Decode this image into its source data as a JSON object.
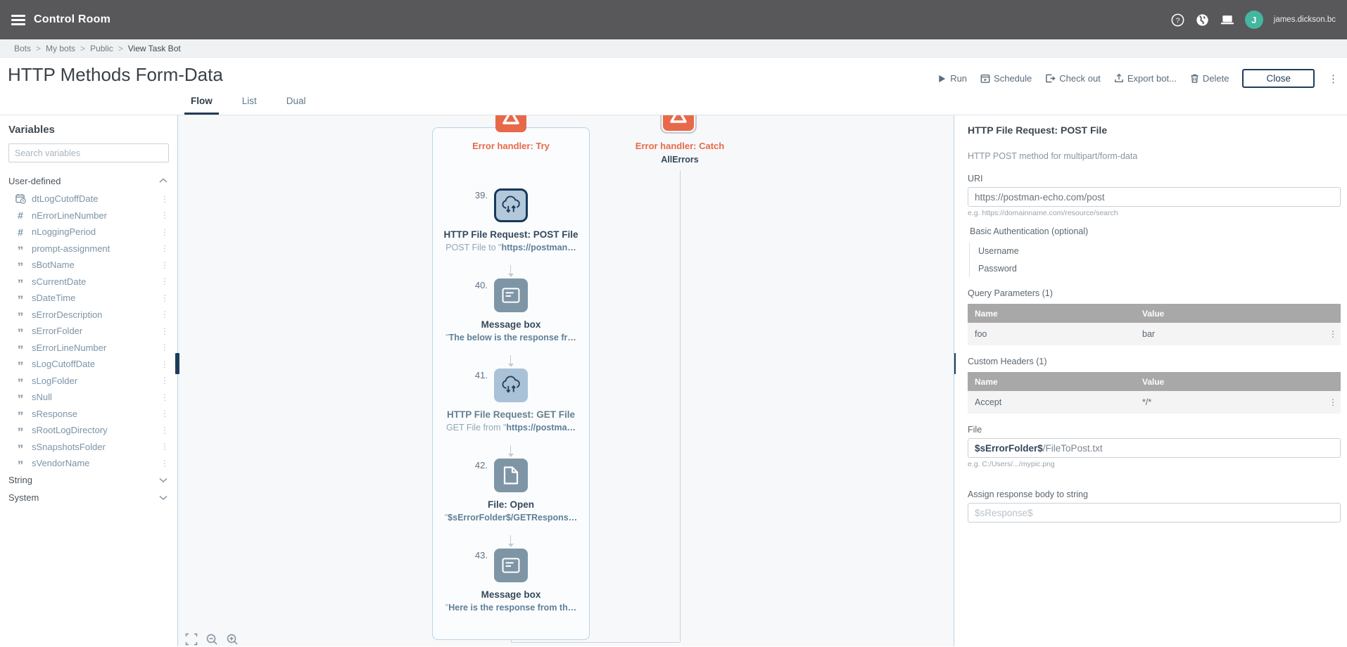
{
  "topbar": {
    "brand": "Control Room",
    "user": "james.dickson.bc",
    "avatar_initial": "J"
  },
  "breadcrumb": {
    "items": [
      "Bots",
      "My bots",
      "Public",
      "View Task Bot"
    ],
    "separator": ">"
  },
  "page": {
    "title": "HTTP Methods Form-Data"
  },
  "toolbar": {
    "run": "Run",
    "schedule": "Schedule",
    "check_out": "Check out",
    "export_bot": "Export bot...",
    "delete": "Delete",
    "close": "Close"
  },
  "tabs": {
    "flow": "Flow",
    "list": "List",
    "dual": "Dual"
  },
  "icons": {
    "kebab": "⋮",
    "more": "⋮",
    "string_type": "”",
    "number_type": "#"
  },
  "sidebar": {
    "heading": "Variables",
    "search_placeholder": "Search variables",
    "sections": {
      "user_defined": "User-defined",
      "string": "String",
      "system": "System"
    },
    "variables": [
      {
        "name": "dtLogCutoffDate",
        "type": "datetime"
      },
      {
        "name": "nErrorLineNumber",
        "type": "number"
      },
      {
        "name": "nLoggingPeriod",
        "type": "number"
      },
      {
        "name": "prompt-assignment",
        "type": "string"
      },
      {
        "name": "sBotName",
        "type": "string"
      },
      {
        "name": "sCurrentDate",
        "type": "string"
      },
      {
        "name": "sDateTime",
        "type": "string"
      },
      {
        "name": "sErrorDescription",
        "type": "string"
      },
      {
        "name": "sErrorFolder",
        "type": "string"
      },
      {
        "name": "sErrorLineNumber",
        "type": "string"
      },
      {
        "name": "sLogCutoffDate",
        "type": "string"
      },
      {
        "name": "sLogFolder",
        "type": "string"
      },
      {
        "name": "sNull",
        "type": "string"
      },
      {
        "name": "sResponse",
        "type": "string"
      },
      {
        "name": "sRootLogDirectory",
        "type": "string"
      },
      {
        "name": "sSnapshotsFolder",
        "type": "string"
      },
      {
        "name": "sVendorName",
        "type": "string"
      }
    ]
  },
  "flow": {
    "try_label": "Error handler: Try",
    "catch_label": "Error handler: Catch",
    "catch_sub": "AllErrors",
    "steps": [
      {
        "num": "39.",
        "title": "HTTP File Request: POST File",
        "sub_prefix": "POST File to \"",
        "sub_bold": "https://postman…"
      },
      {
        "num": "40.",
        "title": "Message box",
        "sub_prefix": "\"",
        "sub_bold": "The below is the response fr…"
      },
      {
        "num": "41.",
        "title": "HTTP File Request: GET File",
        "sub_prefix": "GET File from \"",
        "sub_bold": "https://postma…"
      },
      {
        "num": "42.",
        "title": "File: Open",
        "sub_prefix": "\"",
        "sub_bold": "$sErrorFolder$/GETRespons…"
      },
      {
        "num": "43.",
        "title": "Message box",
        "sub_prefix": "\"",
        "sub_bold": "Here is the response from th…"
      }
    ]
  },
  "properties": {
    "title": "HTTP File Request: POST File",
    "description": "HTTP POST method for multipart/form-data",
    "uri_label": "URI",
    "uri_value": "https://postman-echo.com/post",
    "uri_hint": "e.g. https://domainname.com/resource/search",
    "basic_auth_label": "Basic Authentication (optional)",
    "username_label": "Username",
    "password_label": "Password",
    "query_params_label": "Query Parameters (1)",
    "query_params": {
      "headers": [
        "Name",
        "Value"
      ],
      "rows": [
        [
          "foo",
          "bar"
        ]
      ]
    },
    "custom_headers_label": "Custom Headers (1)",
    "custom_headers": {
      "headers": [
        "Name",
        "Value"
      ],
      "rows": [
        [
          "Accept",
          "*/*"
        ]
      ]
    },
    "file_label": "File",
    "file_value_bold": "$sErrorFolder$",
    "file_value_rest": "/FileToPost.txt",
    "file_hint": "e.g. C:/Users/.../mypic.png",
    "assign_label": "Assign response body to string",
    "assign_placeholder": "$sResponse$"
  },
  "colors": {
    "accent_navy": "#1d3d5c",
    "orange": "#e8694a",
    "avatar_green": "#43b79f",
    "panel_border_blue": "#b9d4e6"
  }
}
